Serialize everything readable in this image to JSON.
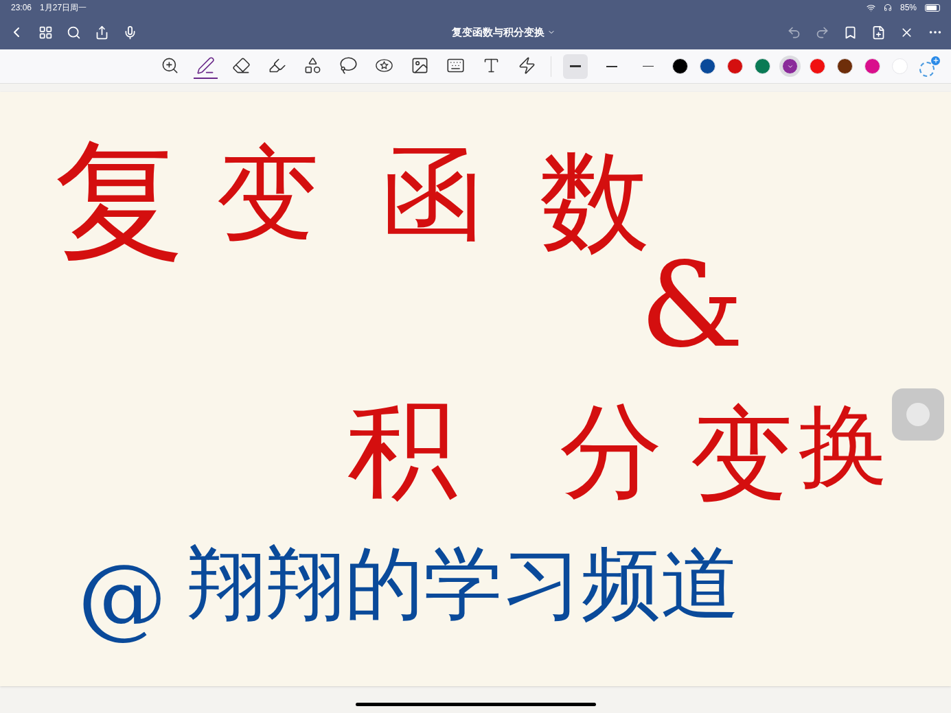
{
  "status_bar": {
    "time": "23:06",
    "date": "1月27日周一",
    "battery": "85%"
  },
  "nav": {
    "title": "复变函数与积分变换"
  },
  "tools": [
    {
      "kind": "zoom",
      "selected": false
    },
    {
      "kind": "pen",
      "selected": true
    },
    {
      "kind": "eraser",
      "selected": false
    },
    {
      "kind": "highlighter",
      "selected": false
    },
    {
      "kind": "shapes",
      "selected": false
    },
    {
      "kind": "lasso",
      "selected": false
    },
    {
      "kind": "sticker",
      "selected": false
    },
    {
      "kind": "image",
      "selected": false
    },
    {
      "kind": "keyboard",
      "selected": false
    },
    {
      "kind": "text",
      "selected": false
    },
    {
      "kind": "laser",
      "selected": false
    }
  ],
  "stroke_widths": [
    {
      "selected": true
    },
    {
      "selected": false
    },
    {
      "selected": false
    }
  ],
  "colors": [
    {
      "color": "#000000",
      "selected": false
    },
    {
      "color": "#0a4a9a",
      "selected": false
    },
    {
      "color": "#d40f0f",
      "selected": false
    },
    {
      "color": "#0a7a55",
      "selected": false
    },
    {
      "color": "#8a2a9a",
      "selected": true
    },
    {
      "color": "#f01010",
      "selected": false
    },
    {
      "color": "#6e2e0a",
      "selected": false
    },
    {
      "color": "#d90f8c",
      "selected": false
    },
    {
      "color": "#ffffff",
      "selected": false
    }
  ],
  "ink": [
    {
      "text": "复",
      "color": "#d40f0f"
    },
    {
      "text": "变",
      "color": "#d40f0f"
    },
    {
      "text": "函",
      "color": "#d40f0f"
    },
    {
      "text": "数",
      "color": "#d40f0f"
    },
    {
      "text": "&",
      "color": "#d40f0f"
    },
    {
      "text": "积",
      "color": "#d40f0f"
    },
    {
      "text": "分",
      "color": "#d40f0f"
    },
    {
      "text": "变",
      "color": "#d40f0f"
    },
    {
      "text": "换",
      "color": "#d40f0f"
    },
    {
      "text": "@",
      "color": "#0a4a9a"
    },
    {
      "text": "翔翔的学习频道",
      "color": "#0a4a9a"
    }
  ]
}
